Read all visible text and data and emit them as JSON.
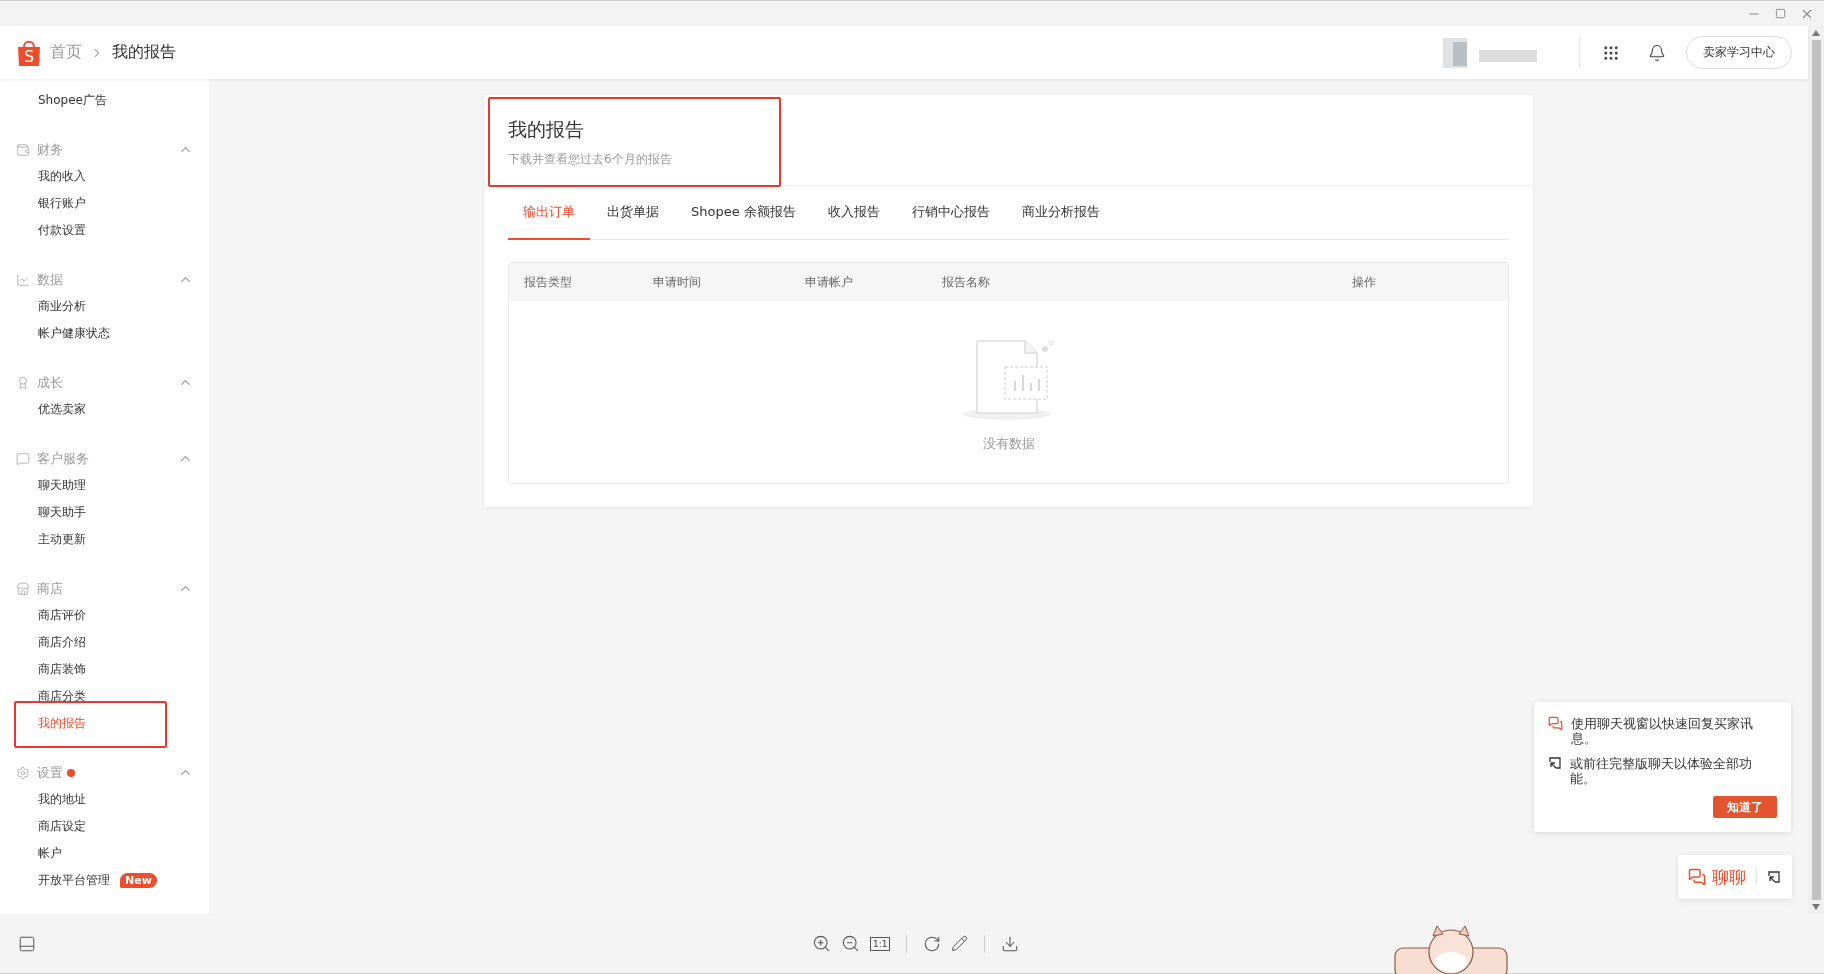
{
  "header": {
    "logo_letter": "S",
    "breadcrumbs": [
      {
        "label": "首页",
        "current": false
      },
      {
        "label": "我的报告",
        "current": true
      }
    ],
    "learning_button": "卖家学习中心"
  },
  "sidebar": {
    "sections": [
      {
        "items": [
          {
            "label": "Shopee广告",
            "selected": false,
            "annotated": false
          }
        ]
      },
      {
        "title": "财务",
        "expanded": true,
        "dot": false,
        "items": [
          {
            "label": "我的收入",
            "selected": false,
            "annotated": false
          },
          {
            "label": "银行账户",
            "selected": false,
            "annotated": false
          },
          {
            "label": "付款设置",
            "selected": false,
            "annotated": false
          }
        ]
      },
      {
        "title": "数据",
        "expanded": true,
        "dot": false,
        "items": [
          {
            "label": "商业分析",
            "selected": false,
            "annotated": false
          },
          {
            "label": "帐户健康状态",
            "selected": false,
            "annotated": false
          }
        ]
      },
      {
        "title": "成长",
        "expanded": true,
        "dot": false,
        "items": [
          {
            "label": "优选卖家",
            "selected": false,
            "annotated": false
          }
        ]
      },
      {
        "title": "客户服务",
        "expanded": true,
        "dot": false,
        "items": [
          {
            "label": "聊天助理",
            "selected": false,
            "annotated": false
          },
          {
            "label": "聊天助手",
            "selected": false,
            "annotated": false
          },
          {
            "label": "主动更新",
            "selected": false,
            "annotated": false
          }
        ]
      },
      {
        "title": "商店",
        "expanded": true,
        "dot": false,
        "items": [
          {
            "label": "商店评价",
            "selected": false,
            "annotated": false
          },
          {
            "label": "商店介绍",
            "selected": false,
            "annotated": false
          },
          {
            "label": "商店装饰",
            "selected": false,
            "annotated": false
          },
          {
            "label": "商店分类",
            "selected": false,
            "annotated": false
          },
          {
            "label": "我的报告",
            "selected": true,
            "annotated": true
          }
        ]
      },
      {
        "title": "设置",
        "expanded": true,
        "dot": true,
        "items": [
          {
            "label": "我的地址",
            "selected": false,
            "annotated": false
          },
          {
            "label": "商店设定",
            "selected": false,
            "annotated": false
          },
          {
            "label": "帐户",
            "selected": false,
            "annotated": false
          },
          {
            "label": "开放平台管理",
            "selected": false,
            "annotated": false,
            "badge": "New"
          }
        ]
      }
    ]
  },
  "report": {
    "title": "我的报告",
    "subtitle": "下载并查看您过去6个月的报告",
    "annotated": true,
    "tabs": [
      {
        "label": "输出订单",
        "selected": true
      },
      {
        "label": "出货单据",
        "selected": false
      },
      {
        "label": "Shopee 余额报告",
        "selected": false
      },
      {
        "label": "收入报告",
        "selected": false
      },
      {
        "label": "行销中心报告",
        "selected": false
      },
      {
        "label": "商业分析报告",
        "selected": false
      }
    ],
    "table": {
      "columns": [
        "报告类型",
        "申请时间",
        "申请帐户",
        "报告名称",
        "操作"
      ],
      "empty_text": "没有数据"
    }
  },
  "chat_tip": {
    "lines": [
      "使用聊天视窗以快速回复买家讯息。",
      "或前往完整版聊天以体验全部功能。"
    ],
    "button": "知道了"
  },
  "chat_button": {
    "label": "聊聊"
  },
  "viewer_toolbar": {
    "actual_size_label": "1:1"
  }
}
